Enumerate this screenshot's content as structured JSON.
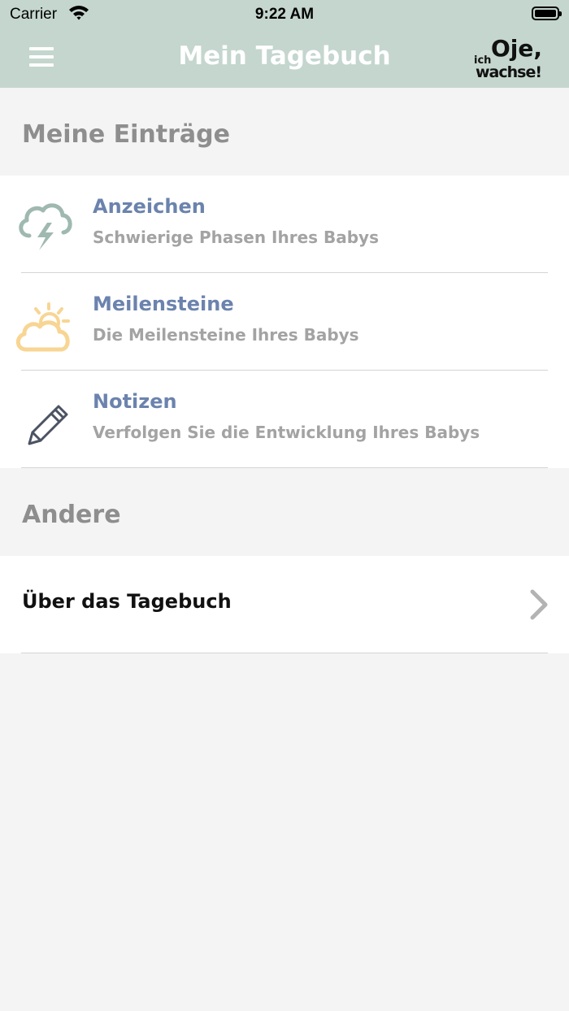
{
  "status_bar": {
    "carrier": "Carrier",
    "time": "9:22 AM"
  },
  "nav": {
    "title": "Mein Tagebuch",
    "logo_text": {
      "line1": "Oje,",
      "small": "ich",
      "line2": "wachse!"
    }
  },
  "sections": {
    "entries_header": "Meine Einträge",
    "other_header": "Andere"
  },
  "entries": [
    {
      "title": "Anzeichen",
      "subtitle": "Schwierige Phasen Ihres Babys",
      "icon": "storm-cloud-icon"
    },
    {
      "title": "Meilensteine",
      "subtitle": "Die Meilensteine Ihres Babys",
      "icon": "sun-cloud-icon"
    },
    {
      "title": "Notizen",
      "subtitle": "Verfolgen Sie die Entwicklung Ihres Babys",
      "icon": "pencil-icon"
    }
  ],
  "other": [
    {
      "label": "Über das Tagebuch",
      "icon": "chevron-right-icon"
    }
  ],
  "colors": {
    "header_green": "#c4d6cd",
    "title_blue": "#6b83ad",
    "storm_icon": "#9fb9b0",
    "sun_icon": "#f8d593",
    "pencil_icon": "#4b5363"
  }
}
